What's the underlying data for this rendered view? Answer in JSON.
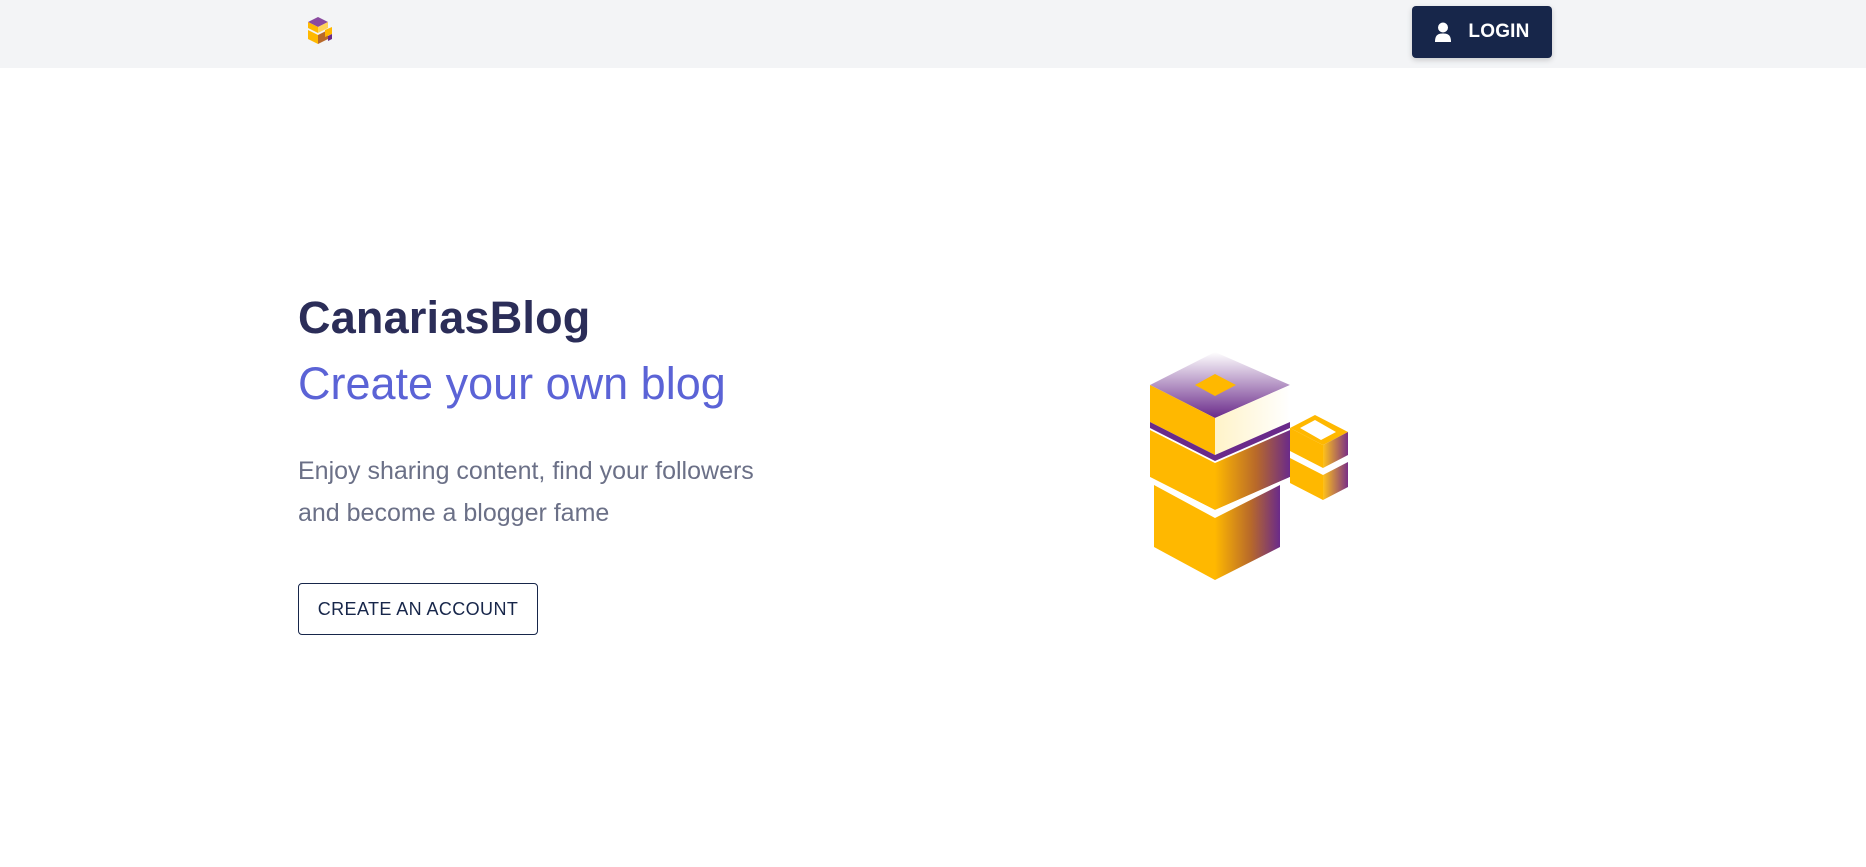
{
  "header": {
    "logo_icon": "blocks-logo-icon",
    "login_button": {
      "label": "LOGIN",
      "icon": "user-icon"
    }
  },
  "hero": {
    "title": "CanariasBlog",
    "subtitle": "Create your own blog",
    "description_line1": "Enjoy sharing content, find your followers",
    "description_line2": "and become a blogger fame",
    "cta_label": "CREATE AN ACCOUNT",
    "illustration_icon": "blocks-illustration"
  },
  "colors": {
    "header_bg": "#f3f4f6",
    "primary_dark": "#17264a",
    "title": "#2b2d58",
    "subtitle": "#5b63d6",
    "description": "#6b7087",
    "accent_yellow": "#ffb800",
    "accent_purple": "#6a2a8a"
  }
}
